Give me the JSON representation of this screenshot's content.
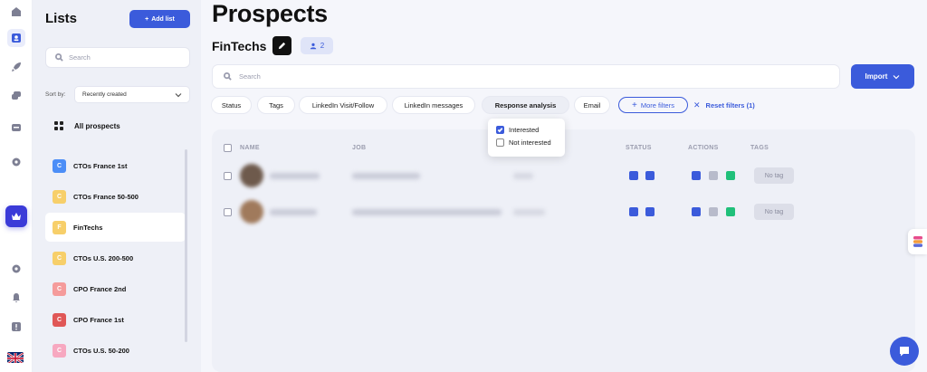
{
  "rail": {
    "icons": [
      "home-icon",
      "contacts-icon",
      "rocket-icon",
      "messages-icon",
      "inbox-icon",
      "settings-icon",
      "crown-icon",
      "gear-icon",
      "bell-icon",
      "alert-icon",
      "uk-flag-icon"
    ],
    "active": "contacts-icon"
  },
  "lists_panel": {
    "title": "Lists",
    "add_button": "Add list",
    "search_placeholder": "Search",
    "sort_label": "Sort by:",
    "sort_value": "Recently created",
    "all_prospects": "All prospects",
    "items": [
      {
        "letter": "C",
        "label": "CTOs France 1st",
        "color": "#4c8ef7",
        "active": false
      },
      {
        "letter": "C",
        "label": "CTOs France 50-500",
        "color": "#f7cf6a",
        "active": false
      },
      {
        "letter": "F",
        "label": "FinTechs",
        "color": "#f7cf6a",
        "active": true
      },
      {
        "letter": "C",
        "label": "CTOs U.S. 200-500",
        "color": "#f7cf6a",
        "active": false
      },
      {
        "letter": "C",
        "label": "CPO France 2nd",
        "color": "#f59b9b",
        "active": false
      },
      {
        "letter": "C",
        "label": "CPO France 1st",
        "color": "#e05757",
        "active": false
      },
      {
        "letter": "C",
        "label": "CTOs U.S. 50-200",
        "color": "#f7a8c0",
        "active": false
      }
    ]
  },
  "header": {
    "title": "Prospects",
    "subtitle": "FinTechs",
    "members_count": "2"
  },
  "search": {
    "placeholder": "Search"
  },
  "import_button": "Import",
  "filters": [
    {
      "label": "Status",
      "active": false
    },
    {
      "label": "Tags",
      "active": false
    },
    {
      "label": "LinkedIn Visit/Follow",
      "active": false
    },
    {
      "label": "LinkedIn messages",
      "active": false
    },
    {
      "label": "Response analysis",
      "active": true
    },
    {
      "label": "Email",
      "active": false
    }
  ],
  "more_filters": "More filters",
  "reset_filters": "Reset filters (1)",
  "response_dropdown": {
    "options": [
      {
        "label": "Interested",
        "checked": true
      },
      {
        "label": "Not interested",
        "checked": false
      }
    ]
  },
  "table": {
    "headers": {
      "name": "NAME",
      "job": "JOB",
      "status": "STATUS",
      "actions": "ACTIONS",
      "tags": "TAGS"
    },
    "rows": [
      {
        "tag": "No tag"
      },
      {
        "tag": "No tag"
      }
    ]
  },
  "colors": {
    "accent": "#3b5bdb",
    "success": "#20c07a"
  }
}
